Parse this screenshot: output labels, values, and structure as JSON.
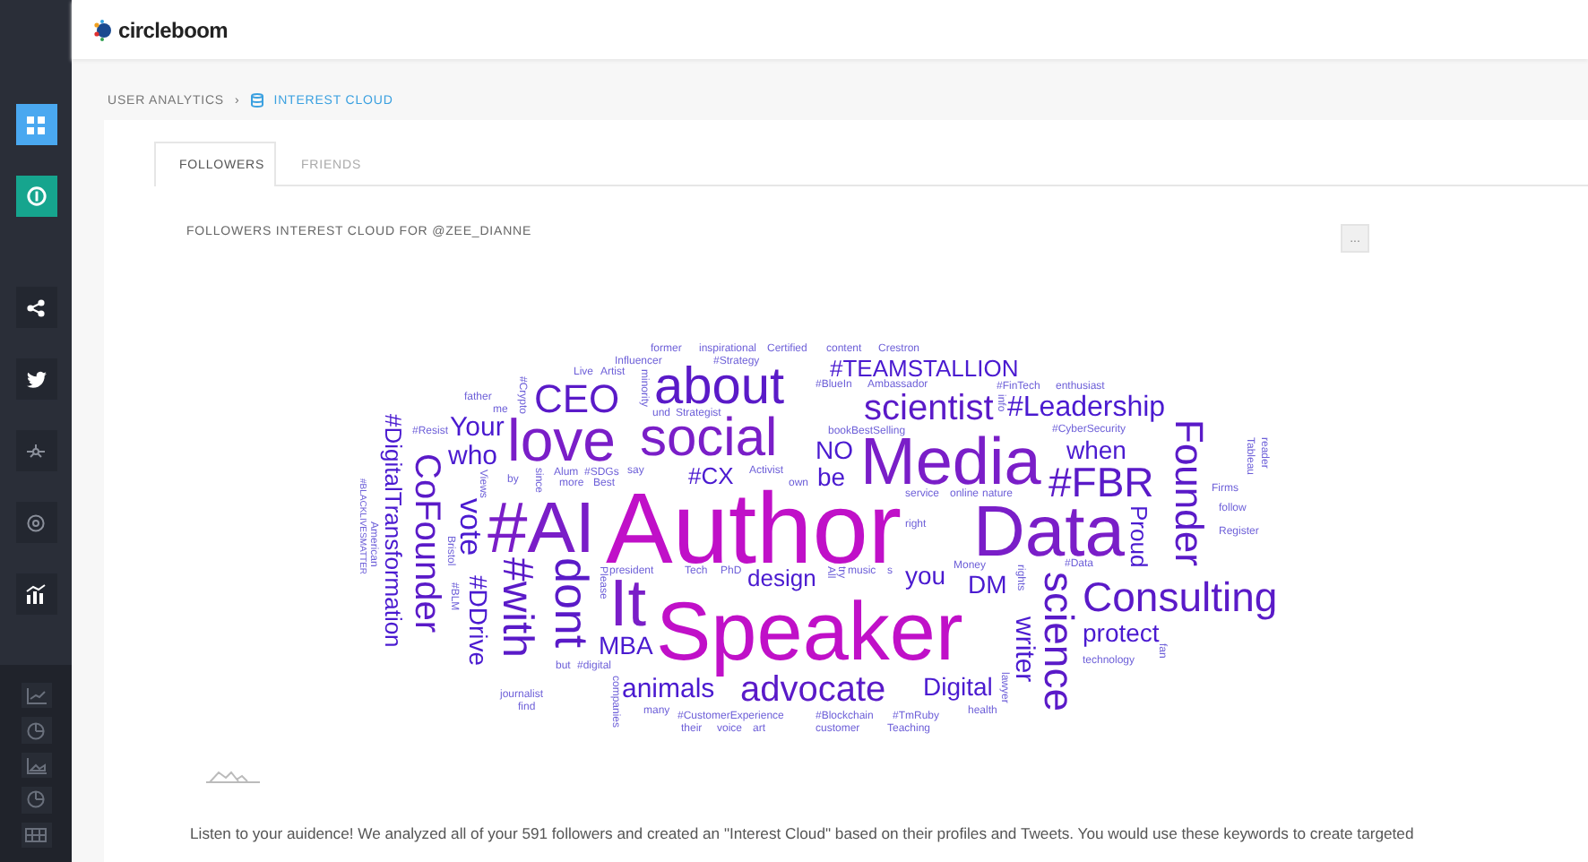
{
  "header": {
    "logo": "circleboom"
  },
  "breadcrumb": [
    {
      "label": "USER ANALYTICS",
      "selected": false
    },
    {
      "label": "›",
      "selected": false
    },
    {
      "label": "INTEREST CLOUD",
      "selected": true
    }
  ],
  "tabs": [
    {
      "label": "FOLLOWERS",
      "selected": true
    },
    {
      "label": "FRIENDS",
      "selected": false
    }
  ],
  "cloud_title": "FOLLOWERS INTEREST CLOUD FOR @ZEE_DIANNE",
  "menu_button": "...",
  "words": [
    "former",
    "inspirational",
    "Certified",
    "content",
    "Crestron",
    "Influencer",
    "#Strategy",
    "#Crypto",
    "Live",
    "Artist",
    "minority",
    "about",
    "#TEAMSTALLION",
    "#BlueIn",
    "Ambassador",
    "info",
    "#FinTech",
    "enthusiast",
    "father",
    "me",
    "CEO",
    "und",
    "Strategist",
    "scientist",
    "#Leadership",
    "#DigitalTransformation",
    "#Resist",
    "Your",
    "love",
    "social",
    "bookBestSelling",
    "#CyberSecurity",
    "Founder",
    "Tableau",
    "reader",
    "CoFounder",
    "who",
    "NO",
    "Media",
    "when",
    "#BLACKLIVESMATTER",
    "Views",
    "by",
    "since",
    "Alum",
    "more",
    "#SDGs",
    "Best",
    "say",
    "#CX",
    "Activist",
    "own",
    "be",
    "service",
    "online",
    "nature",
    "Firms",
    "American",
    "Bristol",
    "vote",
    "#AI",
    "Author",
    "#FBR",
    "right",
    "Data",
    "Proud",
    "follow",
    "Register",
    "#with",
    "dont",
    "Please",
    "president",
    "Tech",
    "PhD",
    "design",
    "All",
    "try",
    "music",
    "s",
    "you",
    "Money",
    "rights",
    "science",
    "#Data",
    "#BLM",
    "#DDrive",
    "It",
    "DM",
    "writer",
    "Consulting",
    "Speaker",
    "protect",
    "MBA",
    "fan",
    "technology",
    "but",
    "#digital",
    "journalist",
    "find",
    "companies",
    "animals",
    "advocate",
    "Digital",
    "lawyer",
    "many",
    "#CustomerExperience",
    "#Blockchain",
    "#TmRuby",
    "health",
    "their",
    "voice",
    "art",
    "customer",
    "Teaching"
  ],
  "description": "Listen to your auidence! We analyzed all of your 591 followers and created an \"Interest Cloud\" based on their profiles and Tweets. You would use these keywords to create targeted"
}
